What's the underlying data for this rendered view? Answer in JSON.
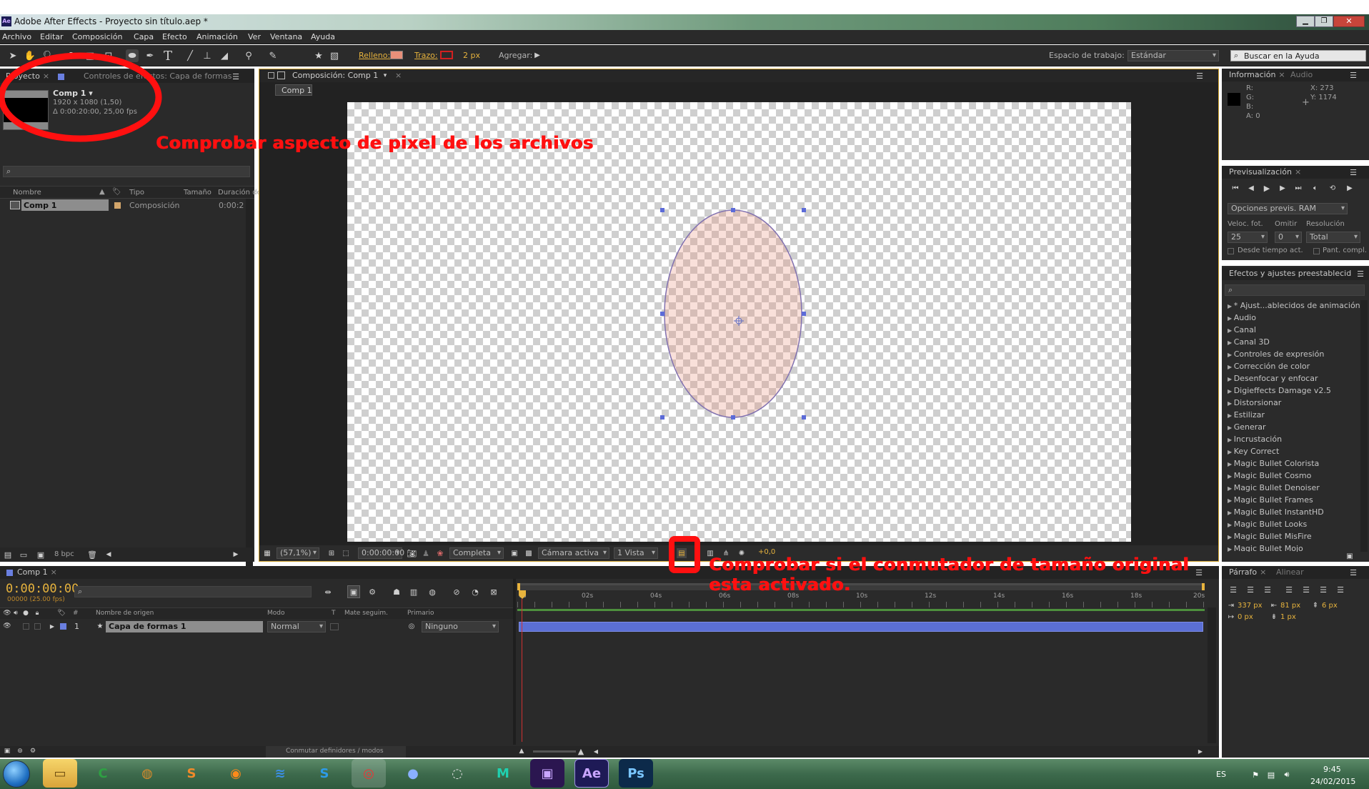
{
  "window": {
    "title": "Adobe After Effects - Proyecto sin título.aep *"
  },
  "menu": [
    "Archivo",
    "Editar",
    "Composición",
    "Capa",
    "Efecto",
    "Animación",
    "Ver",
    "Ventana",
    "Ayuda"
  ],
  "toolbar": {
    "fill_label": "Relleno:",
    "stroke_label": "Trazo:",
    "stroke_width": "2 px",
    "add_label": "Agregar:",
    "workspace_label": "Espacio de trabajo:",
    "workspace_value": "Estándar",
    "help_search": "Buscar en la Ayuda"
  },
  "colors": {
    "fill": "#e8907a",
    "stroke": "#d22020",
    "accent": "#e7b33d",
    "annotation": "#ff1010",
    "timebar": "#5b6fd4"
  },
  "project": {
    "tab": "Proyecto",
    "tab2": "Controles de efectos: Capa de formas",
    "item_name": "Comp 1 ▾",
    "item_size": "1920 x 1080 (1,50)",
    "item_duration": "Δ 0:00:20:00, 25,00 fps",
    "columns": [
      "Nombre",
      "Tipo",
      "Tamaño",
      "Duración de"
    ],
    "row": {
      "name": "Comp 1",
      "type": "Composición",
      "duration": "0:00:2"
    },
    "bpc": "8 bpc"
  },
  "composition": {
    "tab": "Composición: Comp 1",
    "breadcrumb": "Comp 1",
    "zoom": "(57,1%)",
    "timecode": "0:00:00:00",
    "resolution": "Completa",
    "camera": "Cámara activa",
    "views": "1 Vista",
    "exposure": "+0,0"
  },
  "info": {
    "tab": "Información",
    "tab2": "Audio",
    "r": "R:",
    "g": "G:",
    "b": "B:",
    "a": "A:  0",
    "x": "X: 273",
    "y": "Y: 1174"
  },
  "preview": {
    "tab": "Previsualización",
    "options": "Opciones previs. RAM",
    "fps_label": "Veloc. fot.",
    "skip_label": "Omitir",
    "res_label": "Resolución",
    "fps": "25",
    "skip": "0",
    "res": "Total",
    "from_current": "Desde tiempo act.",
    "fullscreen": "Pant. compl."
  },
  "effects": {
    "tab": "Efectos y ajustes preestablecid",
    "items": [
      "* Ajust...ablecidos de animación",
      "Audio",
      "Canal",
      "Canal 3D",
      "Controles de expresión",
      "Corrección de color",
      "Desenfocar y enfocar",
      "Digieffects Damage v2.5",
      "Distorsionar",
      "Estilizar",
      "Generar",
      "Incrustación",
      "Key Correct",
      "Magic Bullet Colorista",
      "Magic Bullet Cosmo",
      "Magic Bullet Denoiser",
      "Magic Bullet Frames",
      "Magic Bullet InstantHD",
      "Magic Bullet Looks",
      "Magic Bullet MisFire",
      "Magic Bullet Mojo"
    ]
  },
  "paragraph": {
    "tab": "Párrafo",
    "tab2": "Alinear",
    "indent_left": "337 px",
    "indent_right": "81 px",
    "space_before": "6 px",
    "first_line": "0 px",
    "space_after": "1 px"
  },
  "timeline": {
    "tab": "Comp 1",
    "timecode": "0:00:00:00",
    "frames": "00000 (25.00 fps)",
    "columns": [
      "#",
      "Nombre de origen",
      "Modo",
      "T",
      "Mate seguim.",
      "Primario"
    ],
    "ruler": [
      "0s",
      "02s",
      "04s",
      "06s",
      "08s",
      "10s",
      "12s",
      "14s",
      "16s",
      "18s",
      "20s"
    ],
    "layer": {
      "num": "1",
      "name": "Capa de formas 1",
      "mode": "Normal",
      "parent": "Ninguno"
    },
    "footer": "Conmutar definidores / modos"
  },
  "annotations": {
    "pixel_aspect": "Comprobar aspecto de pixel de los archivos",
    "switch_line1": "Comprobar si el conmutador de tamaño original",
    "switch_line2": "esta activado."
  },
  "taskbar": {
    "lang": "ES",
    "time": "9:45",
    "date": "24/02/2015",
    "apps": [
      "Explorador",
      "Camtasia",
      "Navegador",
      "Pentaho",
      "Firefox",
      "Navegador 2",
      "Skype",
      "Chrome",
      "Cinema 4D",
      "Steam",
      "Máquina",
      "Premiere",
      "Ae",
      "Ps"
    ]
  }
}
